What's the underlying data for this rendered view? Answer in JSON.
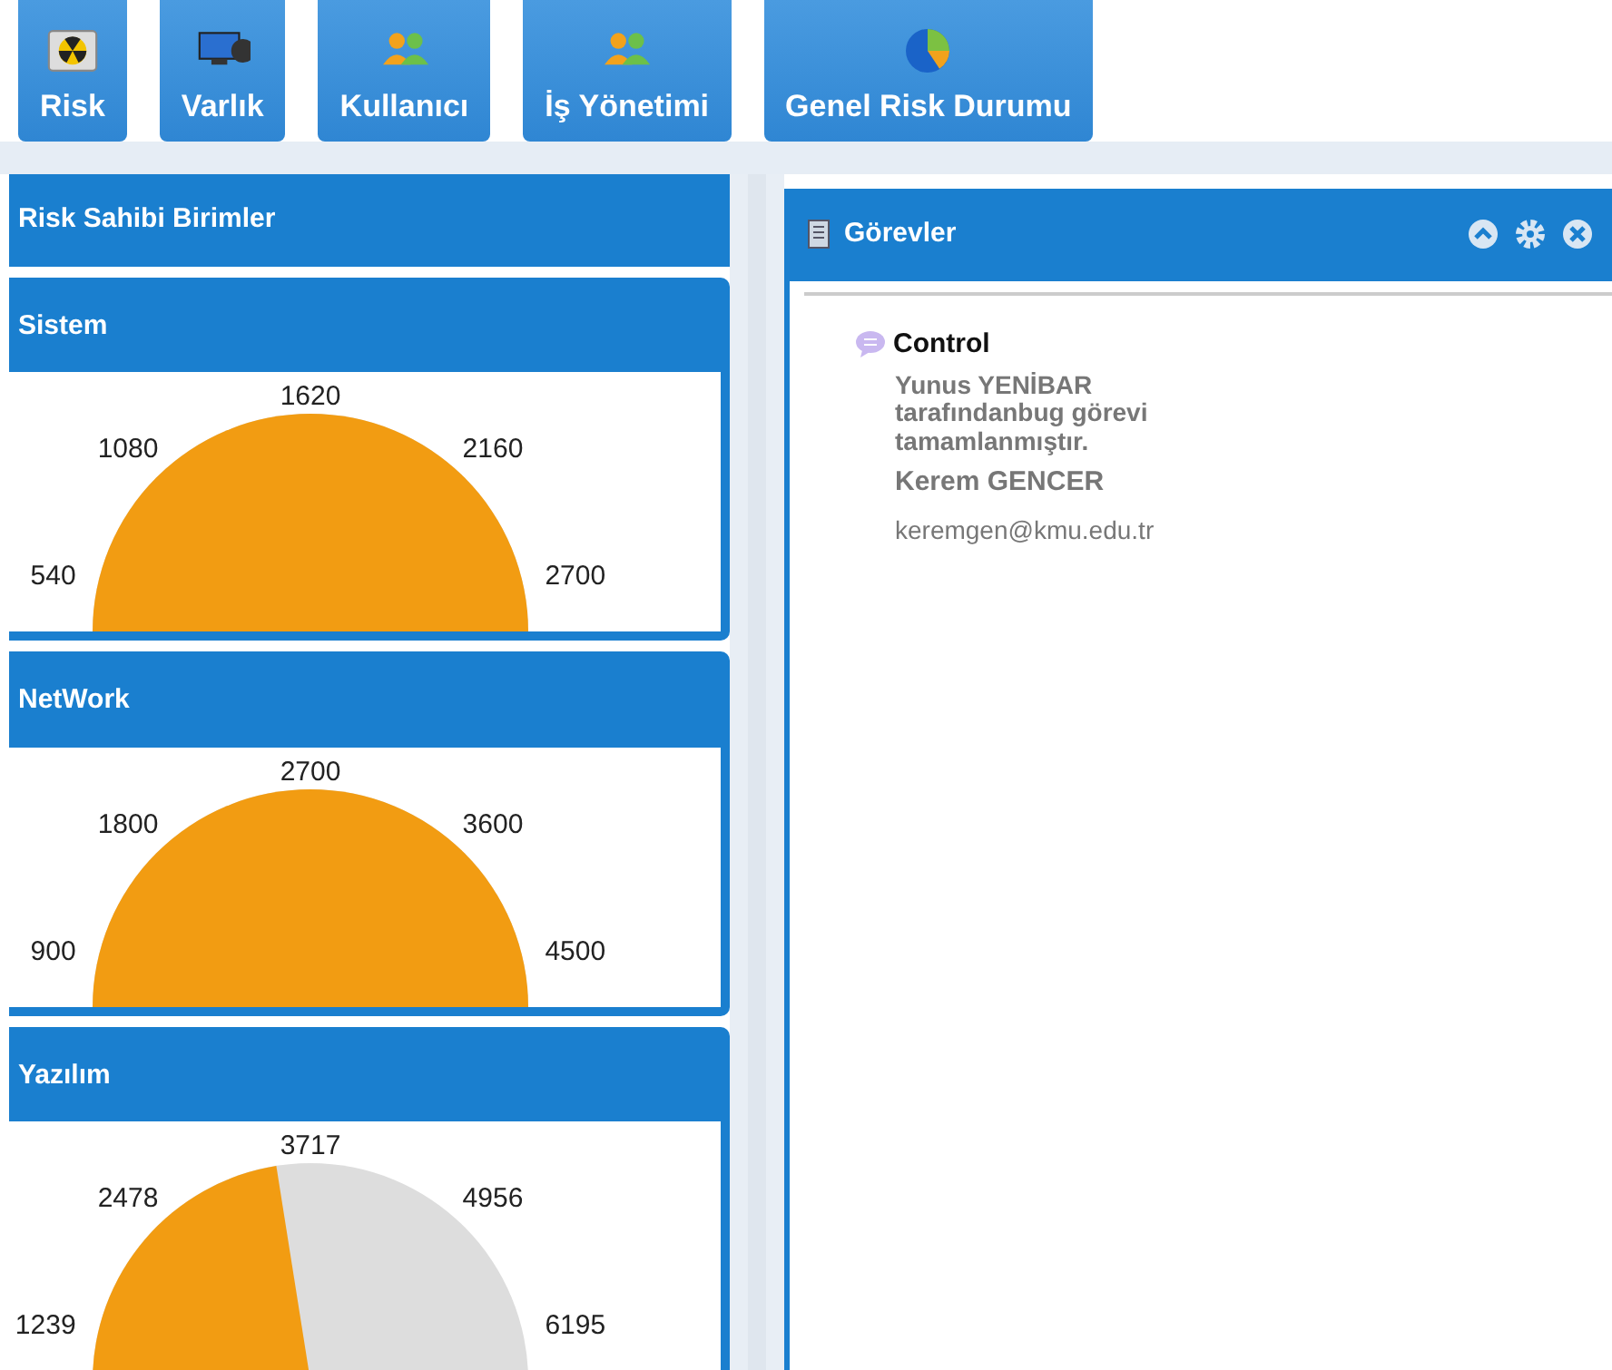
{
  "nav": [
    {
      "label": "Risk"
    },
    {
      "label": "Varlık"
    },
    {
      "label": "Kullanıcı"
    },
    {
      "label": "İş Yönetimi"
    },
    {
      "label": "Genel Risk Durumu"
    }
  ],
  "left_panel": {
    "title": "Risk Sahibi Birimler",
    "units": [
      {
        "name": "Sistem",
        "ticks": [
          "540",
          "1080",
          "1620",
          "2160",
          "2700"
        ]
      },
      {
        "name": "NetWork",
        "ticks": [
          "900",
          "1800",
          "2700",
          "3600",
          "4500"
        ]
      },
      {
        "name": "Yazılım",
        "ticks": [
          "1239",
          "2478",
          "3717",
          "4956",
          "6195"
        ]
      }
    ]
  },
  "tasks_panel": {
    "title": "Görevler",
    "tasks": [
      {
        "title": "Control",
        "message": "Yunus YENİBAR tarafındanbug görevi tamamlanmıştır.",
        "user": "Kerem GENCER",
        "email": "keremgen@kmu.edu.tr"
      }
    ]
  }
}
